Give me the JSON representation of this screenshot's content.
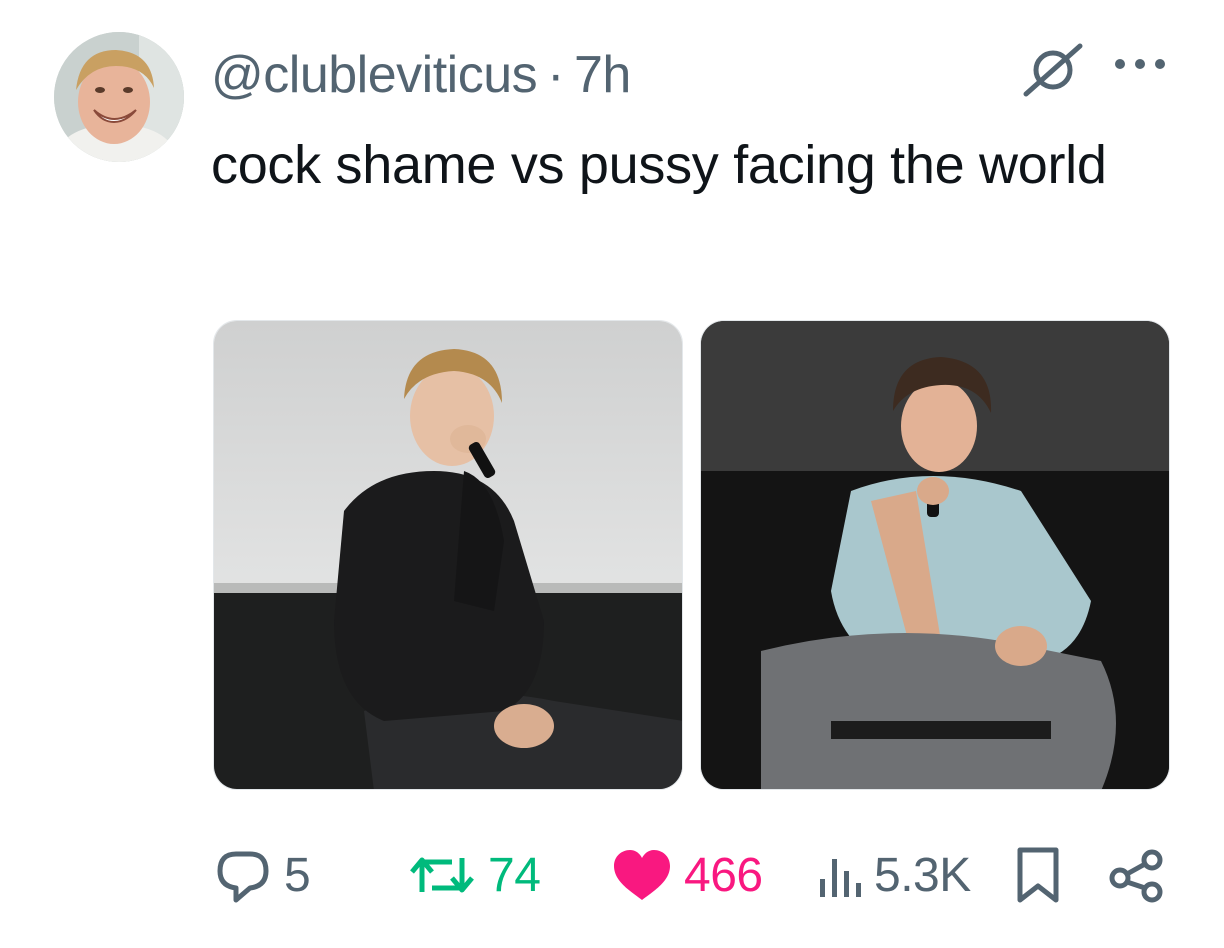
{
  "author": {
    "handle": "@clubleviticus",
    "separator": "·",
    "time": "7h"
  },
  "tweet": {
    "text": "cock shame vs pussy facing the world"
  },
  "icons": {
    "grok": "grok-icon",
    "more": "more-icon",
    "reply": "reply-icon",
    "retweet": "retweet-icon",
    "like": "heart-icon",
    "views": "views-icon",
    "bookmark": "bookmark-icon",
    "share": "share-icon"
  },
  "actions": {
    "replies": "5",
    "retweets": "74",
    "likes": "466",
    "views": "5.3K"
  },
  "colors": {
    "text": "#0f1419",
    "secondary": "#536471",
    "retweet": "#00ba7c",
    "like": "#f91880"
  }
}
